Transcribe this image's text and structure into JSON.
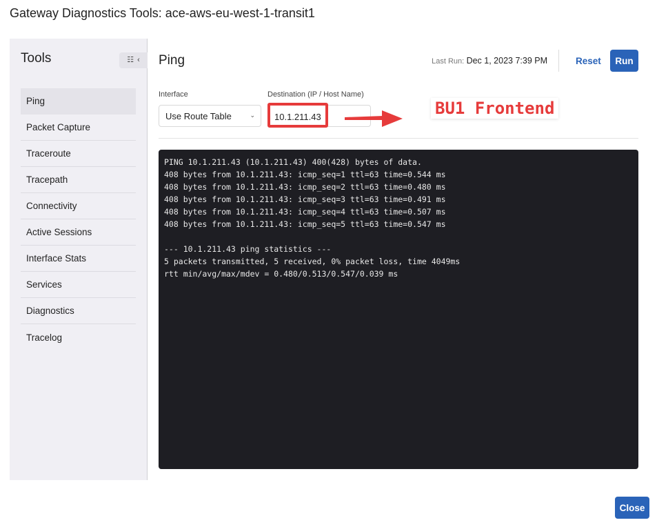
{
  "modal": {
    "title": "Gateway Diagnostics Tools: ace-aws-eu-west-1-transit1",
    "close_label": "Close"
  },
  "sidebar": {
    "title": "Tools",
    "collapse_icons": {
      "filter": "sliders-icon",
      "chevron": "‹"
    },
    "items": [
      {
        "label": "Ping",
        "active": true
      },
      {
        "label": "Packet Capture"
      },
      {
        "label": "Traceroute"
      },
      {
        "label": "Tracepath"
      },
      {
        "label": "Connectivity"
      },
      {
        "label": "Active Sessions"
      },
      {
        "label": "Interface Stats"
      },
      {
        "label": "Services"
      },
      {
        "label": "Diagnostics"
      },
      {
        "label": "Tracelog"
      }
    ]
  },
  "main": {
    "title": "Ping",
    "last_run_label": "Last Run:",
    "last_run_value": "Dec 1, 2023 7:39 PM",
    "reset_label": "Reset",
    "run_label": "Run",
    "interface_label": "Interface",
    "interface_value": "Use Route Table",
    "destination_label": "Destination (IP / Host Name)",
    "destination_value": "10.1.211.43",
    "annotation": "BU1 Frontend",
    "annotation_color": "#e63b3b",
    "accent_color": "#2a63b8",
    "output_lines": [
      "PING 10.1.211.43 (10.1.211.43) 400(428) bytes of data.",
      "408 bytes from 10.1.211.43: icmp_seq=1 ttl=63 time=0.544 ms",
      "408 bytes from 10.1.211.43: icmp_seq=2 ttl=63 time=0.480 ms",
      "408 bytes from 10.1.211.43: icmp_seq=3 ttl=63 time=0.491 ms",
      "408 bytes from 10.1.211.43: icmp_seq=4 ttl=63 time=0.507 ms",
      "408 bytes from 10.1.211.43: icmp_seq=5 ttl=63 time=0.547 ms",
      "",
      "--- 10.1.211.43 ping statistics ---",
      "5 packets transmitted, 5 received, 0% packet loss, time 4049ms",
      "rtt min/avg/max/mdev = 0.480/0.513/0.547/0.039 ms"
    ]
  }
}
